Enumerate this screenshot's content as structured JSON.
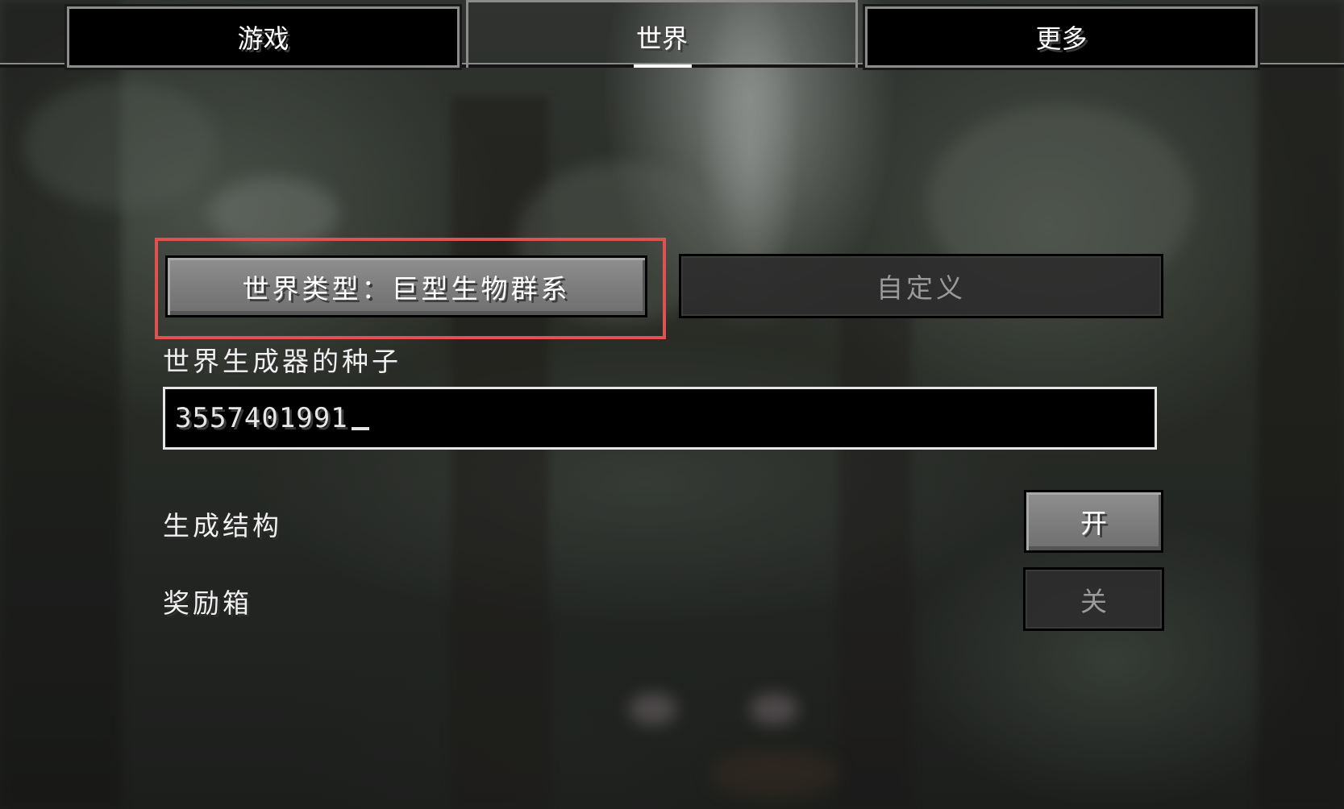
{
  "tabs": [
    {
      "label": "游戏",
      "active": false
    },
    {
      "label": "世界",
      "active": true
    },
    {
      "label": "更多",
      "active": false
    }
  ],
  "world_type_button": {
    "label": "世界类型：巨型生物群系",
    "highlighted": true,
    "highlight_color": "#e0524f"
  },
  "customize_button": {
    "label": "自定义",
    "enabled": false
  },
  "seed": {
    "label": "世界生成器的种子",
    "value": "3557401991"
  },
  "options": [
    {
      "label": "生成结构",
      "value": "开",
      "enabled": true
    },
    {
      "label": "奖励箱",
      "value": "关",
      "enabled": false
    }
  ],
  "colors": {
    "button_enabled": "#7c7c7c",
    "button_disabled": "#2c2c2c",
    "text": "#ffffff",
    "text_disabled": "#9a9a9a"
  }
}
